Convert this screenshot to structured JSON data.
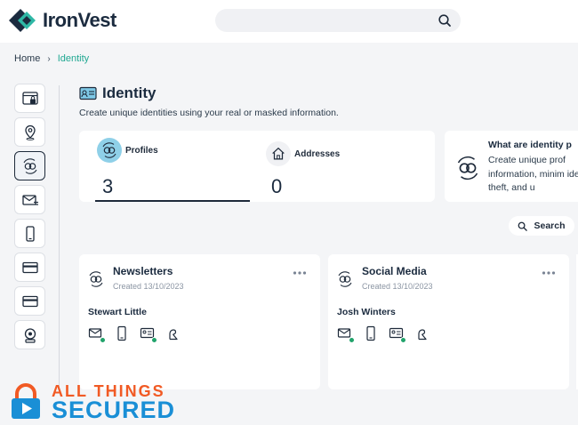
{
  "app": {
    "brand": "IronVest"
  },
  "breadcrumb": {
    "home": "Home",
    "separator": "›",
    "current": "Identity"
  },
  "sidebar": {
    "items": [
      {
        "icon": "browser-lock-icon"
      },
      {
        "icon": "location-pin-icon"
      },
      {
        "icon": "identity-masks-icon",
        "active": true
      },
      {
        "icon": "masked-email-icon"
      },
      {
        "icon": "phone-icon"
      },
      {
        "icon": "card-icon"
      },
      {
        "icon": "card-icon"
      },
      {
        "icon": "webcam-icon"
      }
    ]
  },
  "page": {
    "title": "Identity",
    "subtitle": "Create unique identities using your real or masked information."
  },
  "stats": {
    "profiles": {
      "label": "Profiles",
      "value": "3"
    },
    "addresses": {
      "label": "Addresses",
      "value": "0"
    }
  },
  "info": {
    "title": "What are identity p",
    "body": "Create unique prof information, minim identity theft, and u"
  },
  "search_button": {
    "label": "Search"
  },
  "cards": [
    {
      "title": "Newsletters",
      "created": "Created 13/10/2023",
      "name": "Stewart Little"
    },
    {
      "title": "Social Media",
      "created": "Created 13/10/2023",
      "name": "Josh Winters"
    }
  ],
  "watermark": {
    "line1": "ALL THINGS",
    "line2": "SECURED"
  },
  "colors": {
    "accent_teal": "#20a892",
    "profile_badge": "#8fd0e8",
    "status_green": "#21a36b",
    "watermark_orange": "#f15a24",
    "watermark_blue": "#1a8fd6"
  }
}
